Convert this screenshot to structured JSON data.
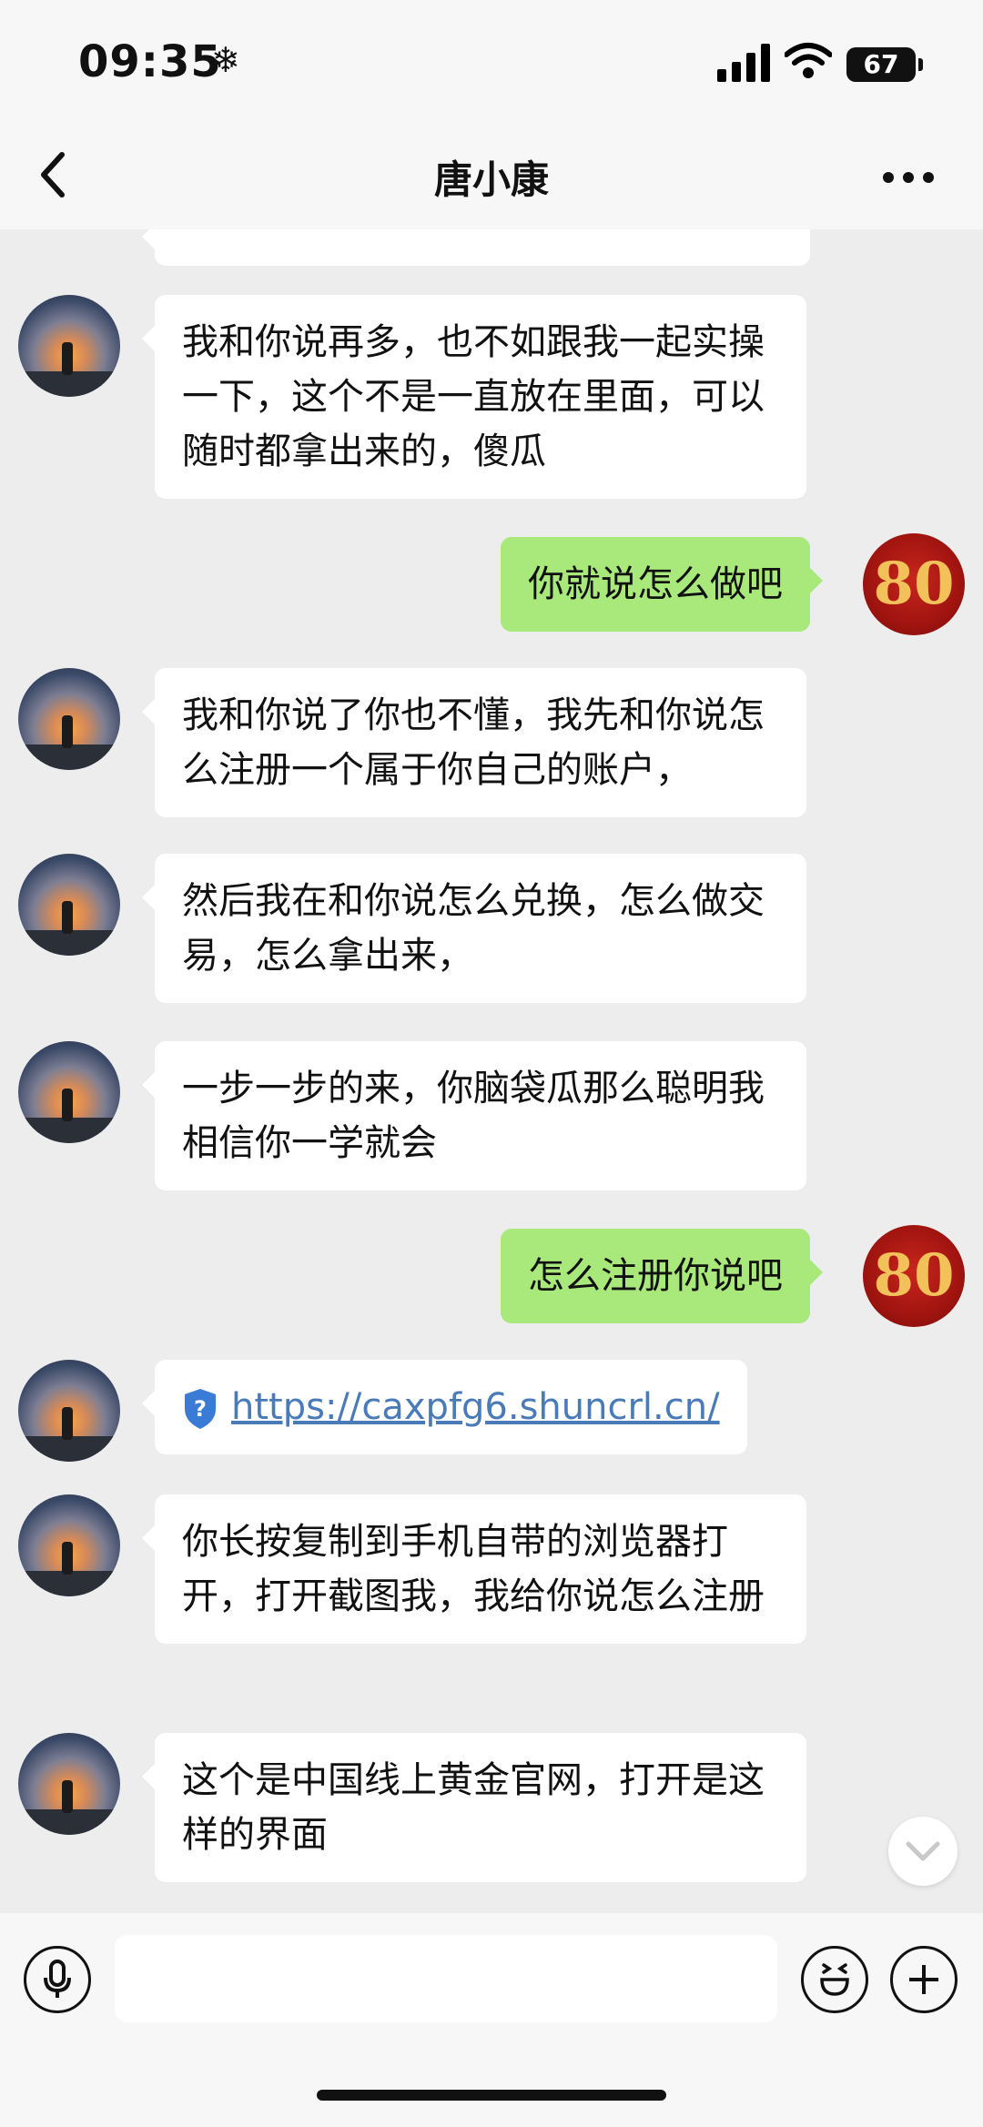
{
  "status_bar": {
    "time": "09:35",
    "snow_glyph": "❄",
    "battery": "67"
  },
  "header": {
    "title": "唐小康"
  },
  "messages": [
    {
      "side": "in",
      "text": "我和你说再多，也不如跟我一起实操一下，这个不是一直放在里面，可以随时都拿出来的，傻瓜"
    },
    {
      "side": "out",
      "text": "你就说怎么做吧"
    },
    {
      "side": "in",
      "text": "我和你说了你也不懂，我先和你说怎么注册一个属于你自己的账户，"
    },
    {
      "side": "in",
      "text": "然后我在和你说怎么兑换，怎么做交易，怎么拿出来，"
    },
    {
      "side": "in",
      "text": "一步一步的来，你脑袋瓜那么聪明我相信你一学就会"
    },
    {
      "side": "out",
      "text": "怎么注册你说吧"
    },
    {
      "side": "in",
      "type": "link",
      "text": "https://caxpfg6.shuncrl.cn/"
    },
    {
      "side": "in",
      "text": "你长按复制到手机自带的浏览器打开，打开截图我，我给你说怎么注册"
    },
    {
      "side": "in",
      "text": "这个是中国线上黄金官网，打开是这样的界面"
    }
  ],
  "self_avatar_text": "80",
  "input": {
    "placeholder": ""
  },
  "icons": {
    "back": "chevron-left-icon",
    "more": "more-dots-icon",
    "mic": "microphone-icon",
    "emoji": "emoji-icon",
    "plus": "plus-icon",
    "scroll": "chevron-down-icon",
    "link": "shield-question-icon"
  },
  "colors": {
    "outgoing_bubble": "#a9e87b",
    "incoming_bubble": "#ffffff",
    "background": "#ededed",
    "link": "#4a7bb9"
  }
}
